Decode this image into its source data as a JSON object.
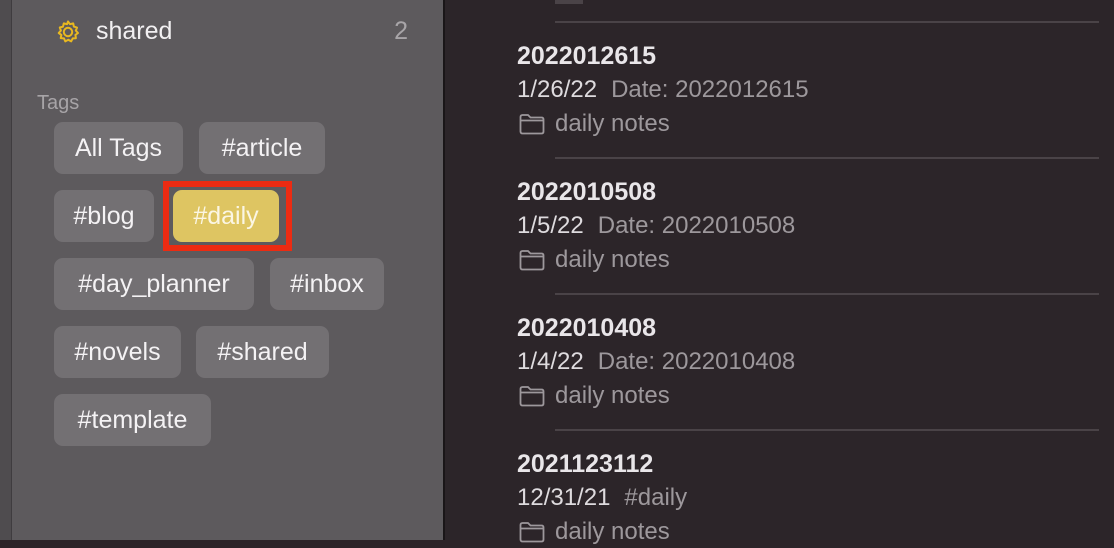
{
  "sidebar": {
    "shared": {
      "label": "shared",
      "count": "2",
      "icon": "gear-icon",
      "icon_color": "#e8b820"
    },
    "tags_heading": "Tags",
    "tags": [
      {
        "label": "All Tags"
      },
      {
        "label": "#article"
      },
      {
        "label": "#blog"
      },
      {
        "label": "#daily",
        "selected": true
      },
      {
        "label": "#day_planner"
      },
      {
        "label": "#inbox"
      },
      {
        "label": "#novels"
      },
      {
        "label": "#shared"
      },
      {
        "label": "#template"
      }
    ],
    "selected_color": "#dec562",
    "highlight_color": "#ec2b12"
  },
  "notes": [
    {
      "title": "2022012615",
      "date": "1/26/22",
      "snippet": "Date: 2022012615",
      "folder": "daily notes"
    },
    {
      "title": "2022010508",
      "date": "1/5/22",
      "snippet": "Date: 2022010508",
      "folder": "daily notes"
    },
    {
      "title": "2022010408",
      "date": "1/4/22",
      "snippet": "Date: 2022010408",
      "folder": "daily notes"
    },
    {
      "title": "2021123112",
      "date": "12/31/21",
      "snippet": "#daily",
      "folder": "daily notes"
    }
  ]
}
